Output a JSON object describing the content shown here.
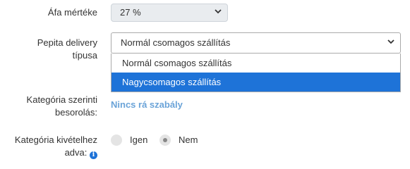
{
  "vat": {
    "label": "Áfa mértéke",
    "value": "27 %"
  },
  "delivery": {
    "label_line1": "Pepita delivery",
    "label_line2": "típusa",
    "value": "Normál csomagos szállítás",
    "options": [
      "Normál csomagos szállítás",
      "Nagycsomagos szállítás"
    ]
  },
  "category": {
    "label_line1": "Kategória szerinti",
    "label_line2": "besorolás:",
    "link": "Nincs rá szabály"
  },
  "category_given": {
    "label_line1": "Kategória kivételhez",
    "label_line2": "adva:",
    "info_icon": "i",
    "options": [
      "Igen",
      "Nem"
    ],
    "selected": "Nem"
  },
  "colors": {
    "highlight": "#1e73d8",
    "link": "#6aa3d8"
  }
}
